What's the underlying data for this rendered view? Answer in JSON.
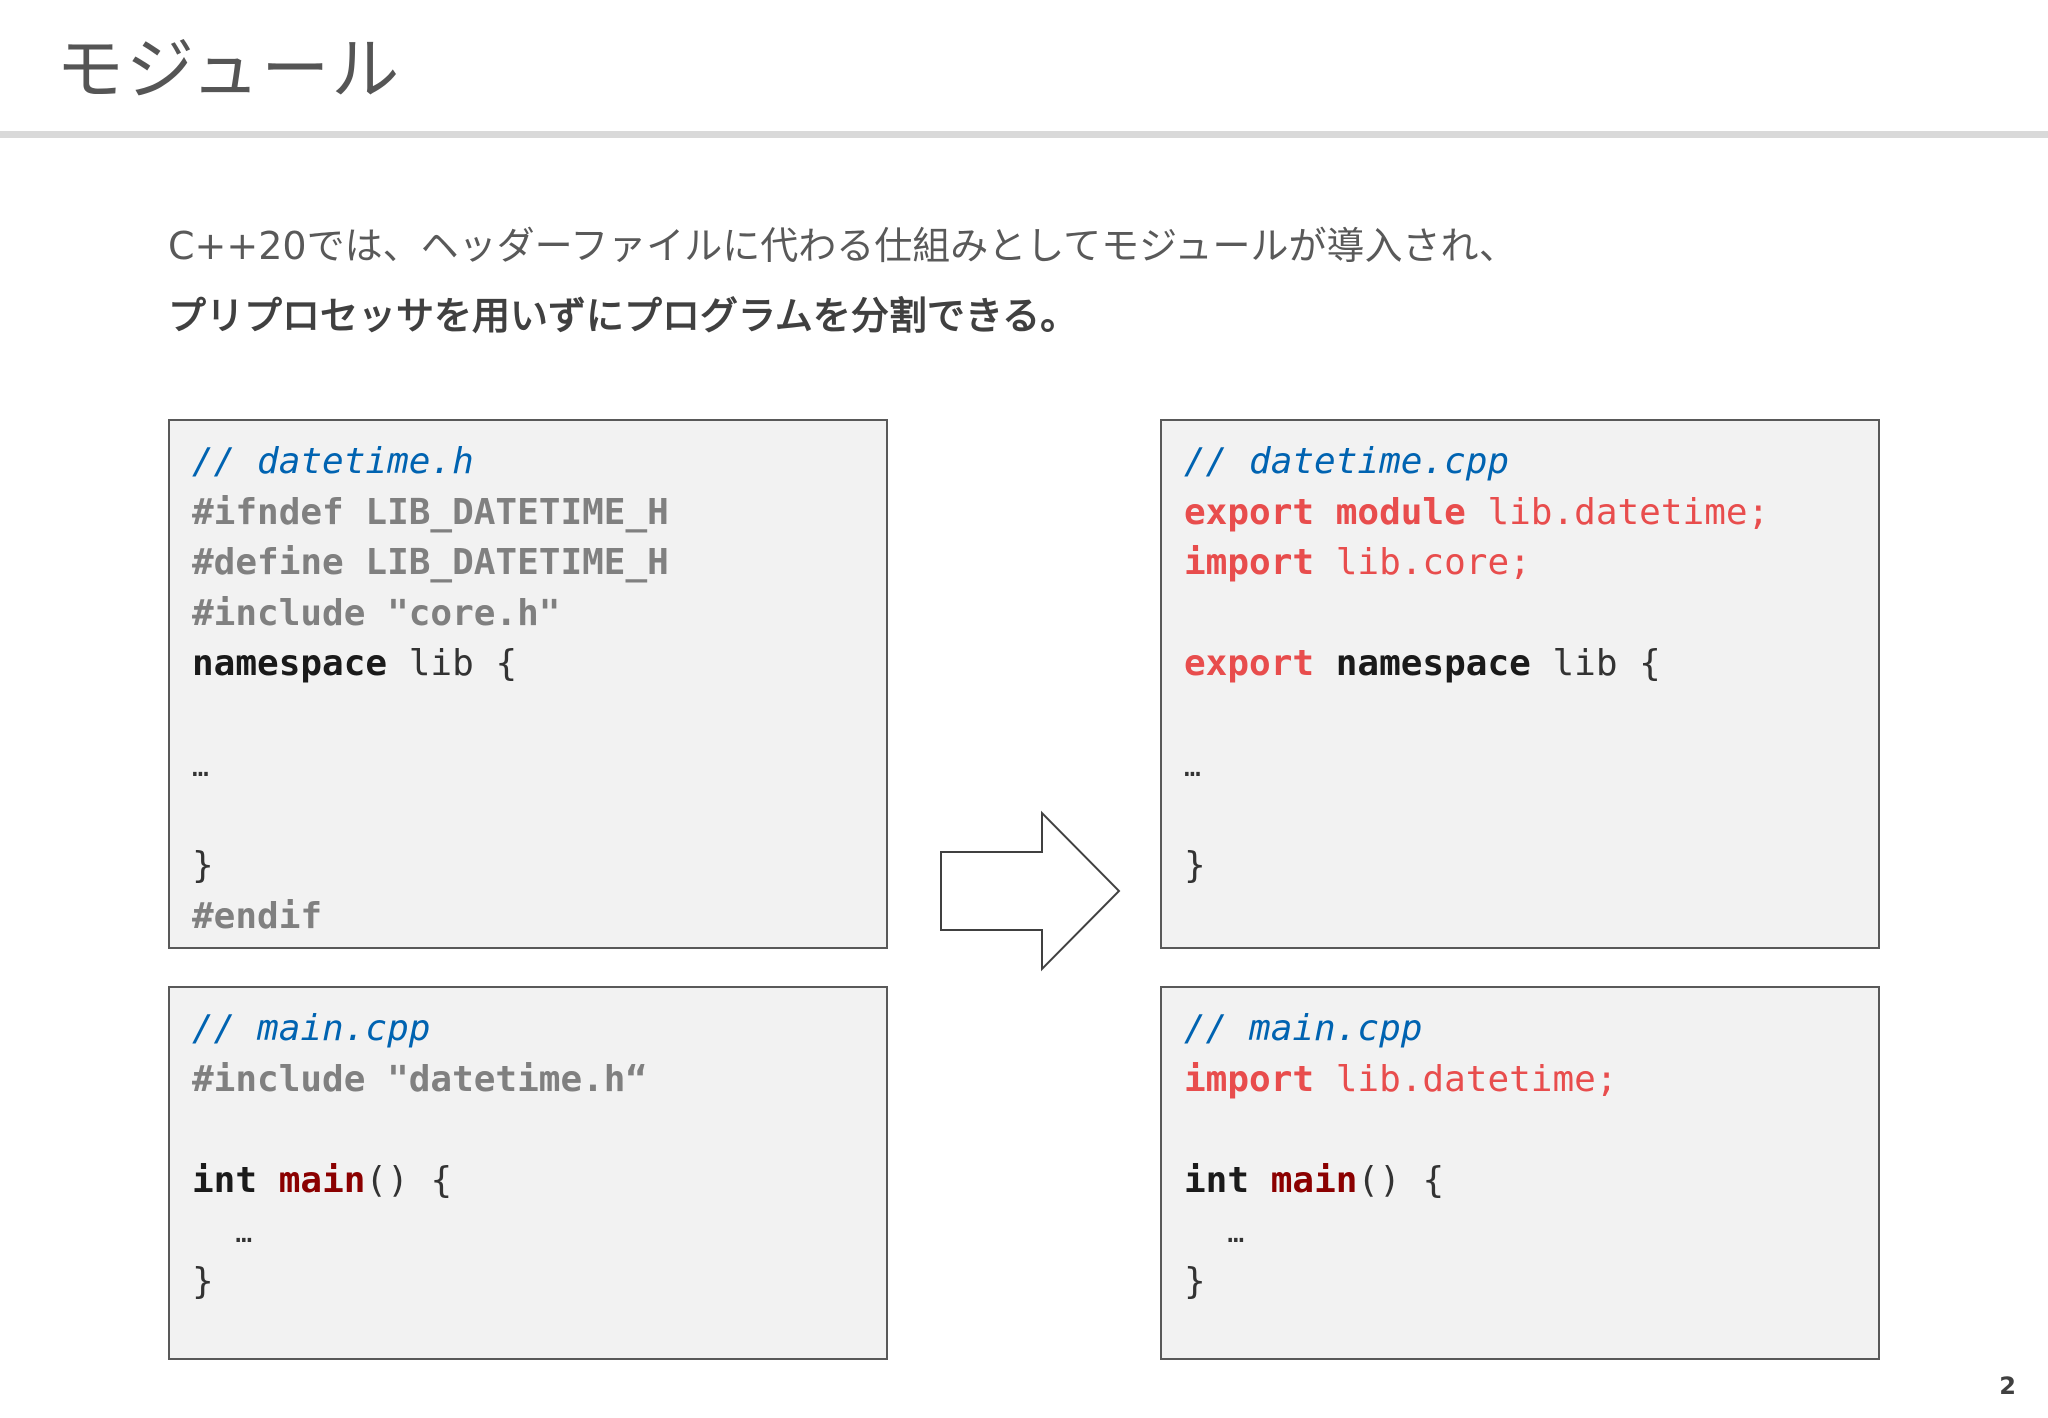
{
  "slide": {
    "title": "モジュール",
    "lead": "C++20では、ヘッダーファイルに代わる仕組みとしてモジュールが導入され、",
    "lead_bold": "プリプロセッサを用いずにプログラムを分割できる。",
    "page_number": "2"
  },
  "boxes": {
    "header_before": {
      "comment": "// datetime.h",
      "ifndef": "#ifndef LIB_DATETIME_H",
      "define": "#define LIB_DATETIME_H",
      "include": "#include \"core.h\"",
      "ns_kw": "namespace",
      "ns_rest": " lib {",
      "ellipsis": "…",
      "close": "}",
      "endif": "#endif"
    },
    "main_before": {
      "comment": "// main.cpp",
      "include": "#include \"datetime.h“",
      "int_kw": "int",
      "main_fn": "main",
      "main_rest": "() {",
      "ellipsis": "…",
      "close": "}"
    },
    "module_after": {
      "comment": "// datetime.cpp",
      "export_kw": "export",
      "module_kw": "module",
      "module_name": " lib.datetime;",
      "import_kw": "import",
      "import_name": " lib.core;",
      "export_kw2": "export",
      "ns_kw": "namespace",
      "ns_rest": " lib {",
      "ellipsis": "…",
      "close": "}"
    },
    "main_after": {
      "comment": "// main.cpp",
      "import_kw": "import",
      "import_name": " lib.datetime;",
      "int_kw": "int",
      "main_fn": "main",
      "main_rest": "() {",
      "ellipsis": "…",
      "close": "}"
    }
  },
  "icons": {
    "arrow": "right-arrow-icon"
  },
  "colors": {
    "comment": "#0063b1",
    "preprocessor": "#808080",
    "module_keyword": "#e84d4d",
    "function_name": "#8b0000",
    "box_background": "#f2f2f2"
  }
}
